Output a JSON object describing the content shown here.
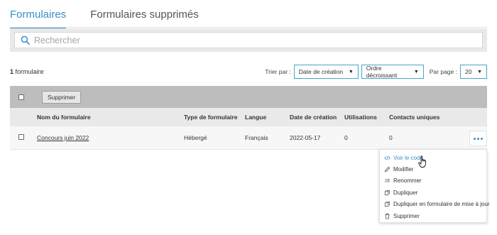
{
  "tabs": [
    {
      "label": "Formulaires",
      "active": true
    },
    {
      "label": "Formulaires supprimés",
      "active": false
    }
  ],
  "search": {
    "placeholder": "Rechercher",
    "icon": "search-icon"
  },
  "summary": {
    "count": "1",
    "label": "formulaire"
  },
  "sort": {
    "label": "Trier par :",
    "field_value": "Date de création",
    "order_value": "Ordre décroissant",
    "per_page_label": "Par page :",
    "per_page_value": "20"
  },
  "toolbar": {
    "delete_label": "Supprimer"
  },
  "table": {
    "columns": [
      "Nom du formulaire",
      "Type de formulaire",
      "Langue",
      "Date de création",
      "Utilisations",
      "Contacts uniques"
    ],
    "rows": [
      {
        "name": "Concours juin 2022",
        "type": "Hébergé",
        "language": "Français",
        "created": "2022-05-17",
        "uses": "0",
        "contacts": "0"
      }
    ]
  },
  "menu": {
    "items": [
      {
        "label": "Voir le code",
        "icon": "code-icon",
        "highlighted": true
      },
      {
        "label": "Modifier",
        "icon": "pencil-icon"
      },
      {
        "label": "Renommer",
        "icon": "rename-icon"
      },
      {
        "label": "Dupliquer",
        "icon": "duplicate-icon"
      },
      {
        "label": "Dupliquer en formulaire de mise à jour",
        "icon": "duplicate-update-icon"
      },
      {
        "label": "Supprimer",
        "icon": "trash-icon"
      }
    ]
  },
  "colors": {
    "accent": "#3a8fc9",
    "select_border": "#48a6c8",
    "toolbar_bg": "#bdbdbd",
    "header_bg": "#e9e9e9"
  }
}
